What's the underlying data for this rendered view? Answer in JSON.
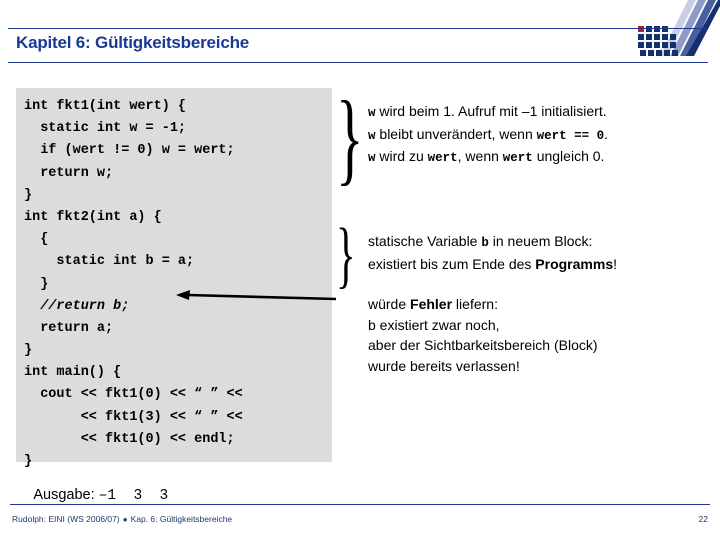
{
  "header": {
    "title": "Kapitel 6: Gültigkeitsbereiche",
    "title_color": "#183a96",
    "rule_color": "#1f3a93",
    "logo_name": "tu-dortmund-logo"
  },
  "code_block": {
    "background": "#dcdcdc",
    "lines": [
      {
        "text": "int fkt1(int wert) {",
        "italic": false
      },
      {
        "text": "  static int w = -1;",
        "italic": false
      },
      {
        "text": "  if (wert != 0) w = wert;",
        "italic": false
      },
      {
        "text": "  return w;",
        "italic": false
      },
      {
        "text": "}",
        "italic": false
      },
      {
        "text": "int fkt2(int a) {",
        "italic": false
      },
      {
        "text": "  {",
        "italic": false
      },
      {
        "text": "    static int b = a;",
        "italic": false
      },
      {
        "text": "  }",
        "italic": false
      },
      {
        "text": "  //return b;",
        "italic": true
      },
      {
        "text": "  return a;",
        "italic": false
      },
      {
        "text": "}",
        "italic": false
      },
      {
        "text": "int main() {",
        "italic": false
      },
      {
        "text": "  cout << fkt1(0) << “ ” <<",
        "italic": false
      },
      {
        "text": "       << fkt1(3) << “ ” <<",
        "italic": false
      },
      {
        "text": "       << fkt1(0) << endl;",
        "italic": false
      },
      {
        "text": "}",
        "italic": false
      }
    ]
  },
  "braces": {
    "brace_fkt1": "}",
    "brace_block": "}"
  },
  "arrow": {
    "name": "pointer-arrow-to-commented-return",
    "direction": "left"
  },
  "notes": {
    "note1": {
      "line1_pre": "w",
      "line1_post": " wird beim 1. Aufruf mit –1 initialisiert.",
      "line2_pre": "w",
      "line2_mid": " bleibt unverändert, wenn ",
      "line2_code": "wert == 0",
      "line2_post": ".",
      "line3_pre": "w",
      "line3_a": " wird zu ",
      "line3_code1": "wert",
      "line3_b": ", wenn ",
      "line3_code2": "wert",
      "line3_c": " ungleich 0."
    },
    "note2": {
      "line1_a": "statische Variable ",
      "line1_code": "b",
      "line1_b": " in neuem Block:",
      "line2_a": "existiert bis zum Ende des ",
      "line2_bold": "Programms",
      "line2_b": "!"
    },
    "note3": {
      "line1_a": "würde ",
      "line1_bold": "Fehler",
      "line1_b": " liefern:",
      "line2": "b existiert zwar noch,",
      "line3": "aber der Sichtbarkeitsbereich (Block)",
      "line4": "wurde bereits verlassen!"
    }
  },
  "ausgabe": {
    "label": "Ausgabe: ",
    "value": "–1  3  3"
  },
  "footer": {
    "author": "Rudolph: EINI (WS 2006/07)",
    "separator": "●",
    "chapter": "Kap. 6: Gültigkeitsbereiche",
    "page": "22",
    "color": "#1f3a70"
  }
}
